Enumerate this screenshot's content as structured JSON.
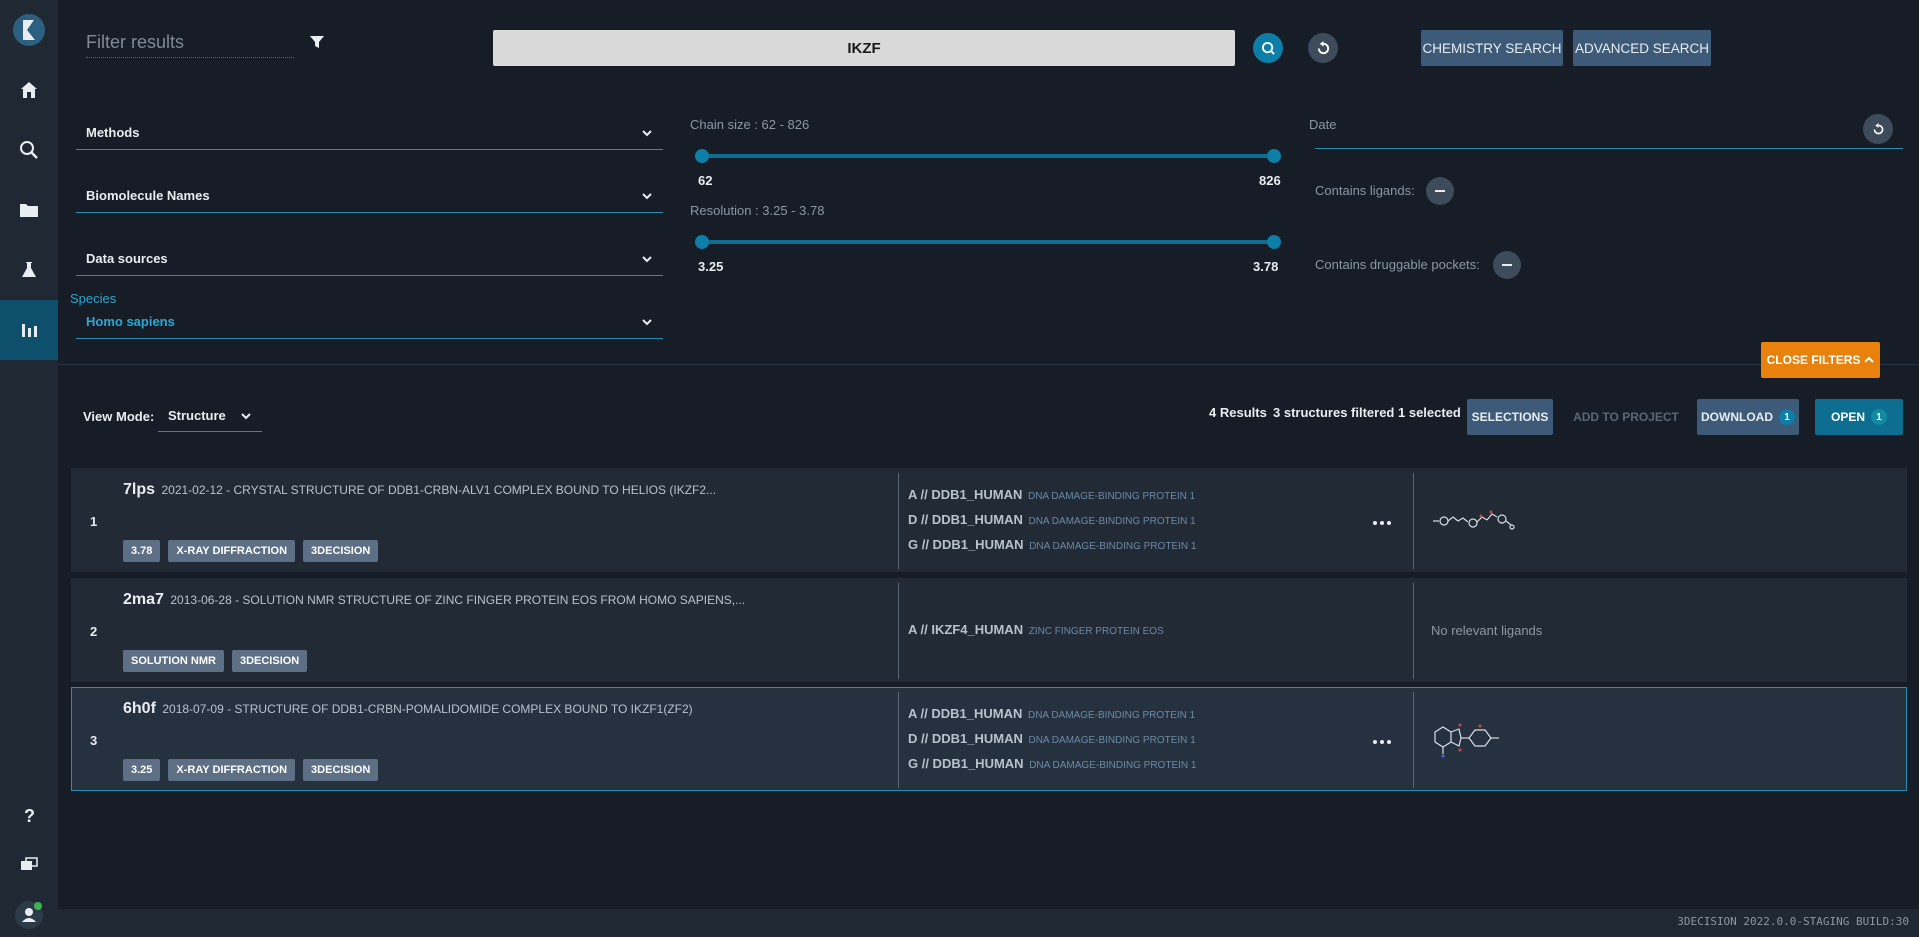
{
  "filter": {
    "placeholder": "Filter results"
  },
  "search": {
    "query": "IKZF"
  },
  "buttons": {
    "chemistry_search": "CHEMISTRY SEARCH",
    "advanced_search": "ADVANCED SEARCH"
  },
  "filters": {
    "methods": "Methods",
    "biomolecule_names": "Biomolecule Names",
    "data_sources": "Data sources",
    "species_label": "Species",
    "species_value": "Homo sapiens",
    "chain_size": {
      "label": "Chain size : 62 - 826",
      "min": "62",
      "max": "826"
    },
    "resolution": {
      "label": "Resolution : 3.25 - 3.78",
      "min": "3.25",
      "max": "3.78"
    },
    "date": "Date",
    "contains_ligands": "Contains ligands:",
    "contains_druggable": "Contains druggable pockets:",
    "close_filters": "CLOSE FILTERS"
  },
  "view": {
    "label": "View Mode:",
    "mode": "Structure"
  },
  "results": {
    "count": "4 Results",
    "filtered": "3 structures filtered",
    "selected": "1 selected",
    "selections": "SELECTIONS",
    "add_to_project": "ADD TO PROJECT",
    "download": "DOWNLOAD",
    "download_count": "1",
    "open": "OPEN",
    "open_count": "1"
  },
  "rows": [
    {
      "num": "1",
      "id": "7lps",
      "title": "2021-02-12 - CRYSTAL STRUCTURE OF DDB1-CRBN-ALV1 COMPLEX BOUND TO HELIOS (IKZF2...",
      "tags": [
        "3.78",
        "X-RAY DIFFRACTION",
        "3DECISION"
      ],
      "chains": [
        {
          "name": "A // DDB1_HUMAN",
          "desc": "DNA DAMAGE-BINDING PROTEIN 1"
        },
        {
          "name": "D // DDB1_HUMAN",
          "desc": "DNA DAMAGE-BINDING PROTEIN 1"
        },
        {
          "name": "G // DDB1_HUMAN",
          "desc": "DNA DAMAGE-BINDING PROTEIN 1"
        }
      ]
    },
    {
      "num": "2",
      "id": "2ma7",
      "title": "2013-06-28 - SOLUTION NMR STRUCTURE OF ZINC FINGER PROTEIN EOS FROM HOMO SAPIENS,...",
      "tags": [
        "SOLUTION NMR",
        "3DECISION"
      ],
      "chains": [
        {
          "name": "A // IKZF4_HUMAN",
          "desc": "ZINC FINGER PROTEIN EOS"
        }
      ],
      "ligands": "No relevant ligands"
    },
    {
      "num": "3",
      "id": "6h0f",
      "title": "2018-07-09 - STRUCTURE OF DDB1-CRBN-POMALIDOMIDE COMPLEX BOUND TO IKZF1(ZF2)",
      "tags": [
        "3.25",
        "X-RAY DIFFRACTION",
        "3DECISION"
      ],
      "chains": [
        {
          "name": "A // DDB1_HUMAN",
          "desc": "DNA DAMAGE-BINDING PROTEIN 1"
        },
        {
          "name": "D // DDB1_HUMAN",
          "desc": "DNA DAMAGE-BINDING PROTEIN 1"
        },
        {
          "name": "G // DDB1_HUMAN",
          "desc": "DNA DAMAGE-BINDING PROTEIN 1"
        }
      ]
    }
  ],
  "footer": {
    "build": "3DECISION 2022.0.0-STAGING BUILD:30"
  },
  "colors": {
    "accent": "#0d7ea8",
    "orange": "#e8820c",
    "sidebar": "#1f2833",
    "background": "#161d26"
  }
}
